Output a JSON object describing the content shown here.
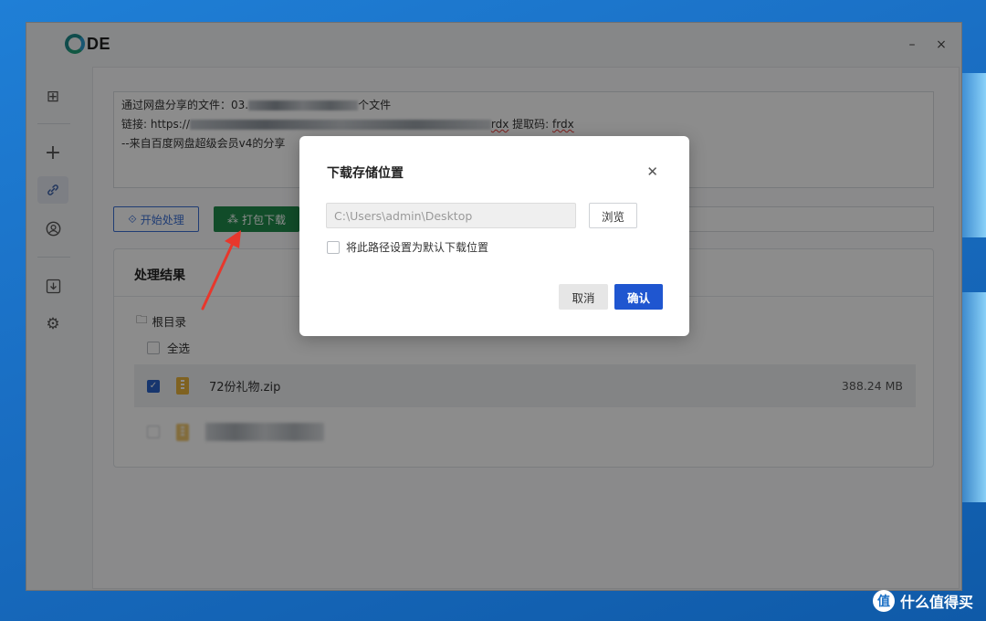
{
  "app": {
    "logo_text": "DE",
    "window_controls": {
      "minimize": "–",
      "close": "×"
    }
  },
  "sidebar": {
    "items": [
      {
        "name": "grid-icon",
        "glyph": "⊞"
      },
      {
        "name": "plus-icon",
        "glyph": "+"
      },
      {
        "name": "link-icon",
        "glyph": "🔗",
        "active": true
      },
      {
        "name": "user-circle-icon",
        "glyph": "◎"
      },
      {
        "name": "download-icon",
        "glyph": "⤓"
      },
      {
        "name": "gear-icon",
        "glyph": "⚙"
      }
    ]
  },
  "input_text": {
    "line1_prefix": "通过网盘分享的文件：03.",
    "line1_suffix": "个文件",
    "line2_prefix": "链接: https://",
    "line2_mid": "rdx",
    "line2_code_label": " 提取码: ",
    "line2_code": "frdx",
    "line3": "--来自百度网盘超级会员v4的分享"
  },
  "actions": {
    "start_label": "开始处理",
    "pack_label": "打包下载"
  },
  "results": {
    "title": "处理结果",
    "root_label": "根目录",
    "select_all_label": "全选",
    "files": [
      {
        "name": "72份礼物.zip",
        "size": "388.24 MB",
        "checked": true
      }
    ]
  },
  "dialog": {
    "title": "下载存储位置",
    "path_placeholder": "C:\\Users\\admin\\Desktop",
    "browse_label": "浏览",
    "default_label": "将此路径设置为默认下载位置",
    "cancel_label": "取消",
    "ok_label": "确认"
  },
  "watermark": {
    "badge": "值",
    "text": "什么值得买"
  }
}
